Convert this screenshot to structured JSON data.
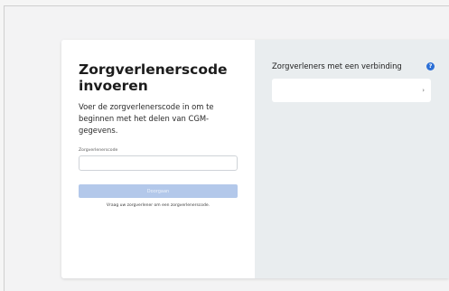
{
  "left": {
    "title": "Zorgverlenerscode invoeren",
    "subtitle": "Voer de zorgverlenerscode in om te beginnen met het delen van CGM-gegevens.",
    "field_label": "Zorgverlenerscode",
    "input_value": "",
    "continue_label": "Doorgaan",
    "hint": "Vraag uw zorgverlener om een zorgverlenerscode."
  },
  "right": {
    "title": "Zorgverleners met een verbinding",
    "help_icon": "question-circle-icon",
    "help_glyph": "?",
    "row_chevron": "›"
  },
  "colors": {
    "accent": "#2b6fd6",
    "button_disabled": "#b3c8ea",
    "right_panel_bg": "#e9edef"
  }
}
